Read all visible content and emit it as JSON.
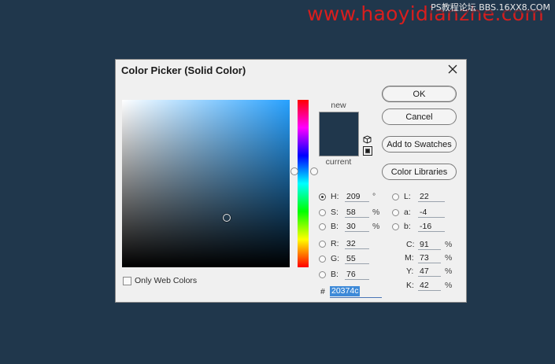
{
  "watermark": {
    "main": "www.haoyidianzhe.com",
    "sub": "PS教程论坛 BBS.16XX8.COM"
  },
  "dialog": {
    "title": "Color Picker (Solid Color)",
    "swatch": {
      "new_label": "new",
      "current_label": "current",
      "new_color": "#20374c",
      "current_color": "#20374c"
    },
    "buttons": {
      "ok": "OK",
      "cancel": "Cancel",
      "add_to_swatches": "Add to Swatches",
      "color_libraries": "Color Libraries"
    },
    "hsb": {
      "h_label": "H:",
      "h_value": "209",
      "h_unit": "°",
      "s_label": "S:",
      "s_value": "58",
      "s_unit": "%",
      "b_label": "B:",
      "b_value": "30",
      "b_unit": "%"
    },
    "rgb": {
      "r_label": "R:",
      "r_value": "32",
      "g_label": "G:",
      "g_value": "55",
      "b_label": "B:",
      "b_value": "76"
    },
    "lab": {
      "l_label": "L:",
      "l_value": "22",
      "a_label": "a:",
      "a_value": "-4",
      "b_label": "b:",
      "b_value": "-16"
    },
    "cmyk": {
      "c_label": "C:",
      "c_value": "91",
      "c_unit": "%",
      "m_label": "M:",
      "m_value": "73",
      "m_unit": "%",
      "y_label": "Y:",
      "y_value": "47",
      "y_unit": "%",
      "k_label": "K:",
      "k_value": "42",
      "k_unit": "%"
    },
    "hex": {
      "label": "#",
      "value": "20374c"
    },
    "only_web_colors_label": "Only Web Colors",
    "selected_mode": "H",
    "base_hue_color": "#27a1ff"
  }
}
